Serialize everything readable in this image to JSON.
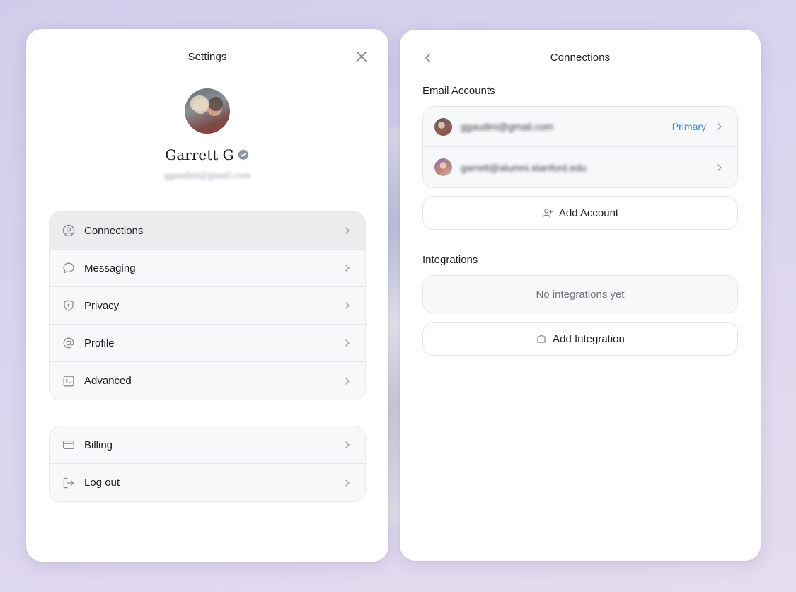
{
  "settings": {
    "title": "Settings",
    "user": {
      "name": "Garrett G",
      "email": "ggaudini@gmail.com"
    },
    "menu_primary": [
      {
        "label": "Connections",
        "icon": "user-circle-icon",
        "active": true
      },
      {
        "label": "Messaging",
        "icon": "chat-bubble-icon"
      },
      {
        "label": "Privacy",
        "icon": "shield-icon"
      },
      {
        "label": "Profile",
        "icon": "at-sign-icon"
      },
      {
        "label": "Advanced",
        "icon": "terminal-icon"
      }
    ],
    "menu_secondary": [
      {
        "label": "Billing",
        "icon": "credit-card-icon"
      },
      {
        "label": "Log out",
        "icon": "logout-icon"
      }
    ]
  },
  "connections": {
    "title": "Connections",
    "email_section_label": "Email Accounts",
    "accounts": [
      {
        "email": "ggaudini@gmail.com",
        "badge": "Primary"
      },
      {
        "email": "garrett@alumni.stanford.edu",
        "badge": ""
      }
    ],
    "add_account_label": "Add Account",
    "integrations_section_label": "Integrations",
    "integrations_empty": "No integrations yet",
    "add_integration_label": "Add Integration"
  },
  "colors": {
    "accent": "#3f86d6",
    "verified": "#8d949e"
  }
}
